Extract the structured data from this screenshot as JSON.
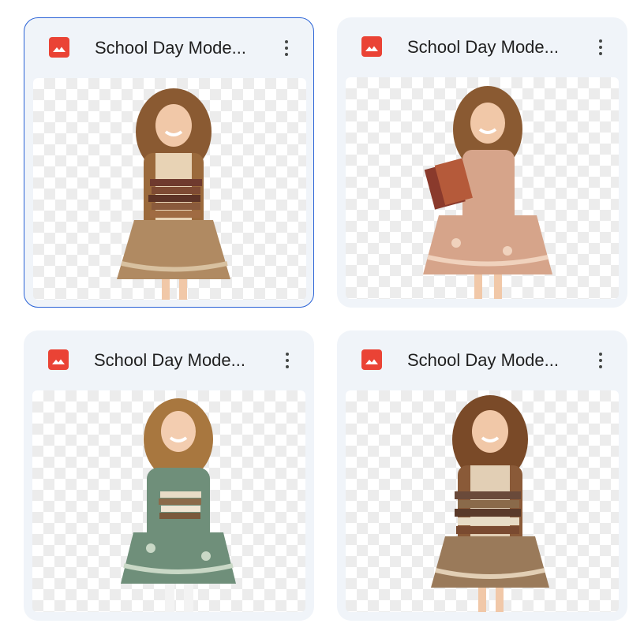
{
  "files": [
    {
      "title": "School Day Mode...",
      "icon": "image-file-icon",
      "selected": true,
      "thumbnail": {
        "hair": "#8a5a32",
        "dress": "#b08a62",
        "dress_pattern": "#d8c1a0",
        "books": "#6f3a2e",
        "books_pose": "front",
        "vest": "#9b6a3c"
      }
    },
    {
      "title": "School Day Mode...",
      "icon": "image-file-icon",
      "selected": false,
      "thumbnail": {
        "hair": "#8a5a32",
        "dress": "#d6a48a",
        "dress_pattern": "#f0d2bd",
        "books": "#8a3a2c",
        "books_pose": "side",
        "vest": "#d6a48a"
      }
    },
    {
      "title": "School Day Mode...",
      "icon": "image-file-icon",
      "selected": false,
      "thumbnail": {
        "hair": "#a8773f",
        "dress": "#6f8f7a",
        "dress_pattern": "#c9d8c6",
        "books": "#8c6b4a",
        "books_pose": "front",
        "vest": "#6f8f7a"
      }
    },
    {
      "title": "School Day Mode...",
      "icon": "image-file-icon",
      "selected": false,
      "thumbnail": {
        "hair": "#7a4a28",
        "dress": "#9a7a5a",
        "dress_pattern": "#e2cfb5",
        "books": "#6a4a3a",
        "books_pose": "front",
        "vest": "#8a5a38"
      }
    }
  ],
  "colors": {
    "card_bg": "#f0f4f9",
    "selected_border": "#2962d6",
    "icon_red": "#ea4335",
    "title_text": "#1f1f1f"
  }
}
